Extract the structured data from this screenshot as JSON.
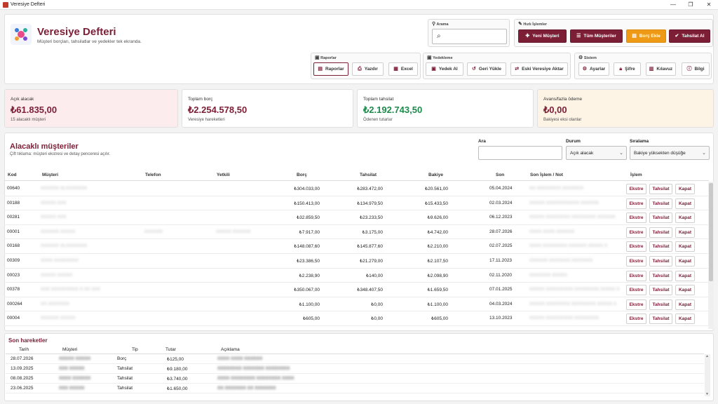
{
  "window": {
    "title": "Veresiye Defteri",
    "controls": [
      "—",
      "❐",
      "✕"
    ]
  },
  "header": {
    "title": "Veresiye Defteri",
    "subtitle": "Müşteri borçları, tahsilatlar ve yedekler tek ekranda."
  },
  "search": {
    "group_label": "Arama",
    "value": ""
  },
  "quick": {
    "group_label": "Hızlı İşlemler",
    "new_customer": "Yeni Müşteri",
    "all_customers": "Tüm Müşteriler",
    "add_debt": "Borç Ekle",
    "collect": "Tahsilat Al"
  },
  "reports": {
    "group_label": "Raporlar",
    "reports": "Raporlar",
    "print": "Yazdır",
    "excel": "Excel"
  },
  "backup": {
    "group_label": "Yedekleme",
    "backup": "Yedek Al",
    "restore": "Geri Yükle",
    "import": "Eski Veresiye Aktar"
  },
  "system": {
    "group_label": "Sistem",
    "settings": "Ayarlar",
    "password": "Şifre",
    "guide": "Kılavuz",
    "info": "Bilgi"
  },
  "stats": [
    {
      "label": "Açık alacak",
      "value": "₺61.835,00",
      "sub": "15 alacaklı müşteri",
      "color": "#7b1e36",
      "bg": "#fdecee"
    },
    {
      "label": "Toplam borç",
      "value": "₺2.254.578,50",
      "sub": "Veresiye hareketleri",
      "color": "#7b1e36",
      "bg": "#ffffff"
    },
    {
      "label": "Toplam tahsilat",
      "value": "₺2.192.743,50",
      "sub": "Ödenen tutarlar",
      "color": "#1e8a4c",
      "bg": "#ffffff"
    },
    {
      "label": "Avans/fazla ödeme",
      "value": "₺0,00",
      "sub": "Bakiyesi eksi olanlar",
      "color": "#7b1e36",
      "bg": "#fdf4e6"
    }
  ],
  "customers": {
    "title": "Alacaklı müşteriler",
    "hint": "Çift tıklama: müşteri ekstresi ve detay penceresi açılır.",
    "filter_label": "Ara",
    "filter_value": "",
    "status_label": "Durum",
    "status_value": "Açık alacak",
    "sort_label": "Sıralama",
    "sort_value": "Bakiye yüksekten düşüğe",
    "columns": [
      "Kod",
      "Müşteri",
      "Telefon",
      "Yetkili",
      "Borç",
      "Tahsilat",
      "Bakiye",
      "Son",
      "Son İşlem / Not",
      "İşlem"
    ],
    "actions": {
      "statement": "Ekstre",
      "collect": "Tahsilat",
      "close": "Kapat"
    },
    "rows": [
      {
        "code": "00640",
        "name": "XXXXXX XLXXXXXXX",
        "phone": "",
        "contact": "",
        "debt": "₺304.033,00",
        "paid": "₺283.472,00",
        "balance": "₺20.561,00",
        "last": "05.04.2024",
        "note": "XX XXXXXXXX XXXXXXX"
      },
      {
        "code": "00188",
        "name": "XXXXX XXX",
        "phone": "",
        "contact": "",
        "debt": "₺150.413,00",
        "paid": "₺134.979,50",
        "balance": "₺15.433,50",
        "last": "02.03.2024",
        "note": "XXXXX XXXXXXXXXXX XXXXXX"
      },
      {
        "code": "00281",
        "name": "XXXXX XXX",
        "phone": "",
        "contact": "",
        "debt": "₺32.859,50",
        "paid": "₺23.233,50",
        "balance": "₺9.626,00",
        "last": "06.12.2023",
        "note": "XXXXX XXXXXXXX XXXXXXXX XXXXXX"
      },
      {
        "code": "00001",
        "name": "XXXXXX XXXXX",
        "phone": "XXXXXX",
        "contact": "XXXXX XXXXXX",
        "debt": "₺7.917,00",
        "paid": "₺3.175,00",
        "balance": "₺4.742,00",
        "last": "28.07.2026",
        "note": "XXXX XXXX XXXXXX"
      },
      {
        "code": "00168",
        "name": "XXXXXX XLXXXXXXX",
        "phone": "",
        "contact": "",
        "debt": "₺148.087,60",
        "paid": "₺145.877,60",
        "balance": "₺2.210,00",
        "last": "02.07.2025",
        "note": "XXXX XXXXXXXX XXXXXX XXXXX X"
      },
      {
        "code": "00309",
        "name": "XXXX XXXXXXXX",
        "phone": "",
        "contact": "",
        "debt": "₺23.386,50",
        "paid": "₺21.279,00",
        "balance": "₺2.107,50",
        "last": "17.11.2023",
        "note": "XXXXXX XXXXXXX XXXXXXX"
      },
      {
        "code": "00023",
        "name": "XXXXX XXXXX",
        "phone": "",
        "contact": "",
        "debt": "₺2.238,90",
        "paid": "₺140,00",
        "balance": "₺2.098,90",
        "last": "02.11.2020",
        "note": "XXXXXXX XXXXX"
      },
      {
        "code": "00378",
        "name": "XXX XXXXXXXXX X XX XXX",
        "phone": "",
        "contact": "",
        "debt": "₺350.067,00",
        "paid": "₺348.407,50",
        "balance": "₺1.659,50",
        "last": "07.01.2025",
        "note": "XXXXX XXXXXXXXX XXXXXXXX XXXXX X"
      },
      {
        "code": "000264",
        "name": "XX XXXXXXX",
        "phone": "",
        "contact": "",
        "debt": "₺1.100,00",
        "paid": "₺0,00",
        "balance": "₺1.100,00",
        "last": "04.03.2024",
        "note": "XXXXX XXXXXXXX XXXXXXXX XXXXX X"
      },
      {
        "code": "00004",
        "name": "XXXXXX XXXXX",
        "phone": "",
        "contact": "",
        "debt": "₺605,00",
        "paid": "₺0,00",
        "balance": "₺605,00",
        "last": "13.10.2023",
        "note": "XXXXX XXXXXXXXX XXXXXXXX"
      }
    ]
  },
  "history": {
    "title": "Son hareketler",
    "columns": [
      "Tarih",
      "Müşteri",
      "Tip",
      "Tutar",
      "Açıklama"
    ],
    "rows": [
      {
        "date": "28.07.2026",
        "customer": "XXXXX XXXXX",
        "type": "Borç",
        "amount": "₺125,00",
        "desc": "XXXX XXXX XXXXXX"
      },
      {
        "date": "13.09.2025",
        "customer": "XXX XXXXX",
        "type": "Tahsilat",
        "amount": "₺9.180,00",
        "desc": "XXXXXXXX XXXXXXX XXXXXXXX"
      },
      {
        "date": "08.08.2025",
        "customer": "XXXX XXXXXX",
        "type": "Tahsilat",
        "amount": "₺3.740,00",
        "desc": "XXXX XXXXXXXX XXXXXXXX XXXX"
      },
      {
        "date": "23.06.2025",
        "customer": "XXX XXXXX",
        "type": "Tahsilat",
        "amount": "₺1.650,00",
        "desc": "XX XXXXXXX XX XXXXXXX"
      }
    ]
  }
}
